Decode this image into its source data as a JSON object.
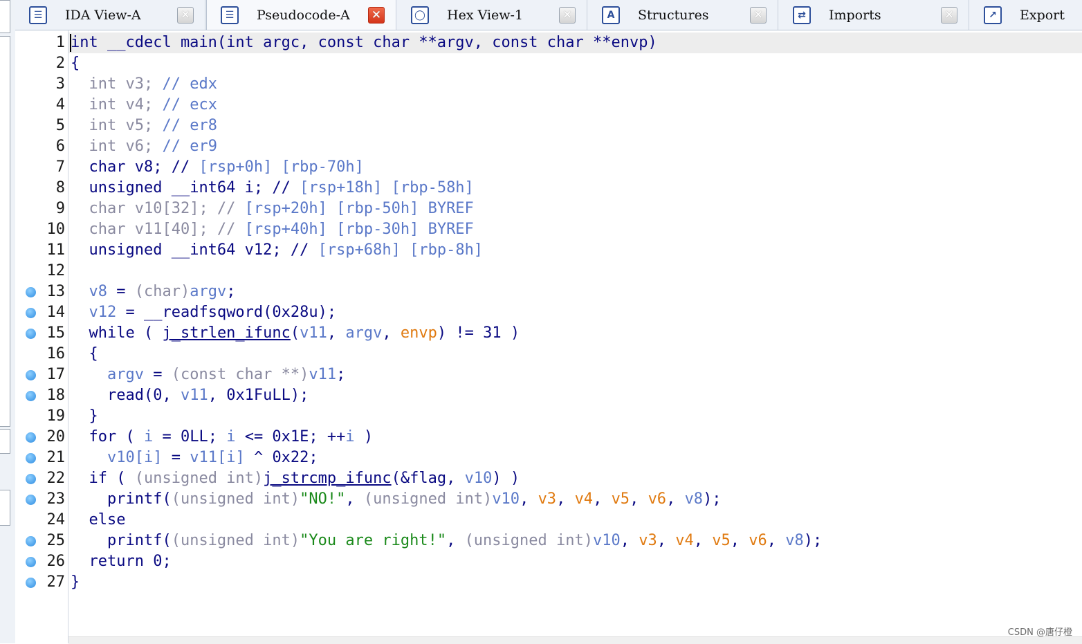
{
  "tabs": [
    {
      "label": "IDA View-A",
      "icon": "ida-view-icon",
      "active": false
    },
    {
      "label": "Pseudocode-A",
      "icon": "pseudocode-icon",
      "active": true
    },
    {
      "label": "Hex View-1",
      "icon": "hex-view-icon",
      "active": false
    },
    {
      "label": "Structures",
      "icon": "structures-icon",
      "active": false
    },
    {
      "label": "Imports",
      "icon": "imports-icon",
      "active": false
    },
    {
      "label": "Export",
      "icon": "exports-icon",
      "active": false
    }
  ],
  "code_lines": [
    {
      "n": "1",
      "bp": false,
      "html": "<span class='k'>int __cdecl main(int argc, const char **argv, const char **envp)</span>"
    },
    {
      "n": "2",
      "bp": false,
      "html": "<span class='p'>{</span>"
    },
    {
      "n": "3",
      "bp": false,
      "html": "  <span class='c'>int v3; </span><span class='cm'>// edx</span>"
    },
    {
      "n": "4",
      "bp": false,
      "html": "  <span class='c'>int v4; </span><span class='cm'>// ecx</span>"
    },
    {
      "n": "5",
      "bp": false,
      "html": "  <span class='c'>int v5; </span><span class='cm'>// er8</span>"
    },
    {
      "n": "6",
      "bp": false,
      "html": "  <span class='c'>int v6; </span><span class='cm'>// er9</span>"
    },
    {
      "n": "7",
      "bp": false,
      "html": "  <span class='k'>char v8; // </span><span class='cm'>[rsp+0h] [rbp-70h]</span>"
    },
    {
      "n": "8",
      "bp": false,
      "html": "  <span class='k'>unsigned __int64 i; // </span><span class='cm'>[rsp+18h] [rbp-58h]</span>"
    },
    {
      "n": "9",
      "bp": false,
      "html": "  <span class='c'>char v10[32]; // </span><span class='cm'>[rsp+20h] [rbp-50h] BYREF</span>"
    },
    {
      "n": "10",
      "bp": false,
      "html": "  <span class='c'>char v11[40]; // </span><span class='cm'>[rsp+40h] [rbp-30h] BYREF</span>"
    },
    {
      "n": "11",
      "bp": false,
      "html": "  <span class='k'>unsigned __int64 v12; // </span><span class='cm'>[rsp+68h] [rbp-8h]</span>"
    },
    {
      "n": "12",
      "bp": false,
      "html": ""
    },
    {
      "n": "13",
      "bp": true,
      "html": "  <span class='v'>v8</span><span class='k'> = </span><span class='c'>(char)</span><span class='v'>argv</span><span class='k'>;</span>"
    },
    {
      "n": "14",
      "bp": true,
      "html": "  <span class='v'>v12</span><span class='k'> = __readfsqword(0x28u);</span>"
    },
    {
      "n": "15",
      "bp": true,
      "html": "  <span class='k'>while ( </span><span class='u'>j_strlen_ifunc</span><span class='k'>(</span><span class='v'>v11</span><span class='k'>, </span><span class='v'>argv</span><span class='k'>, </span><span class='a'>envp</span><span class='k'>) != 31 )</span>"
    },
    {
      "n": "16",
      "bp": false,
      "html": "  <span class='k'>{</span>"
    },
    {
      "n": "17",
      "bp": true,
      "html": "    <span class='v'>argv</span><span class='k'> = </span><span class='c'>(const char **)</span><span class='v'>v11</span><span class='k'>;</span>"
    },
    {
      "n": "18",
      "bp": true,
      "html": "    <span class='k'>read(0, </span><span class='v'>v11</span><span class='k'>, 0x1FuLL);</span>"
    },
    {
      "n": "19",
      "bp": false,
      "html": "  <span class='k'>}</span>"
    },
    {
      "n": "20",
      "bp": true,
      "html": "  <span class='k'>for ( </span><span class='v'>i</span><span class='k'> = 0LL; </span><span class='v'>i</span><span class='k'> &lt;= 0x1E; ++</span><span class='v'>i</span><span class='k'> )</span>"
    },
    {
      "n": "21",
      "bp": true,
      "html": "    <span class='v'>v10[i]</span><span class='k'> = </span><span class='v'>v11[i]</span><span class='k'> ^ 0x22;</span>"
    },
    {
      "n": "22",
      "bp": true,
      "html": "  <span class='k'>if ( </span><span class='c'>(unsigned int)</span><span class='u'>j_strcmp_ifunc</span><span class='k'>(&amp;flag, </span><span class='v'>v10</span><span class='k'>) )</span>"
    },
    {
      "n": "23",
      "bp": true,
      "html": "    <span class='k'>printf(</span><span class='c'>(unsigned int)</span><span class='s'>\"NO!\"</span><span class='k'>, </span><span class='c'>(unsigned int)</span><span class='v'>v10</span><span class='k'>, </span><span class='a'>v3</span><span class='k'>, </span><span class='a'>v4</span><span class='k'>, </span><span class='a'>v5</span><span class='k'>, </span><span class='a'>v6</span><span class='k'>, </span><span class='v'>v8</span><span class='k'>);</span>"
    },
    {
      "n": "24",
      "bp": false,
      "html": "  <span class='k'>else</span>"
    },
    {
      "n": "25",
      "bp": true,
      "html": "    <span class='k'>printf(</span><span class='c'>(unsigned int)</span><span class='s'>\"You are right!\"</span><span class='k'>, </span><span class='c'>(unsigned int)</span><span class='v'>v10</span><span class='k'>, </span><span class='a'>v3</span><span class='k'>, </span><span class='a'>v4</span><span class='k'>, </span><span class='a'>v5</span><span class='k'>, </span><span class='a'>v6</span><span class='k'>, </span><span class='v'>v8</span><span class='k'>);</span>"
    },
    {
      "n": "26",
      "bp": true,
      "html": "  <span class='k'>return 0;</span>"
    },
    {
      "n": "27",
      "bp": true,
      "html": "<span class='k'>}</span>"
    }
  ],
  "watermark": "CSDN @唐仔橙",
  "colors": {
    "keyword": "#0a0a82",
    "variable": "#5a78c8",
    "argument": "#e07a10",
    "string": "#1b8a1b",
    "breakpoint": "#2d8be0"
  }
}
